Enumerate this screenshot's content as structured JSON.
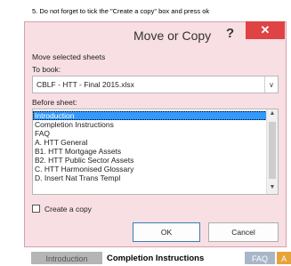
{
  "caption": "5. Do not forget to tick the \"Create a copy\" box and press ok",
  "dialog": {
    "title": "Move or Copy",
    "help": "?",
    "close": "✕",
    "move_label": "Move selected sheets",
    "to_book_label": "To book:",
    "to_book_value": "CBLF - HTT - Final 2015.xlsx",
    "before_sheet_label": "Before sheet:",
    "sheets": [
      "Introduction",
      "Completion Instructions",
      "FAQ",
      "A. HTT General",
      "B1. HTT Mortgage Assets",
      "B2. HTT Public Sector Assets",
      "C. HTT Harmonised Glossary",
      "D. Insert Nat Trans Templ"
    ],
    "create_copy_label": "Create a copy",
    "create_copy_checked": false,
    "ok_label": "OK",
    "cancel_label": "Cancel"
  },
  "sheet_tabs": [
    "Introduction",
    "Completion Instructions",
    "FAQ",
    "A"
  ]
}
